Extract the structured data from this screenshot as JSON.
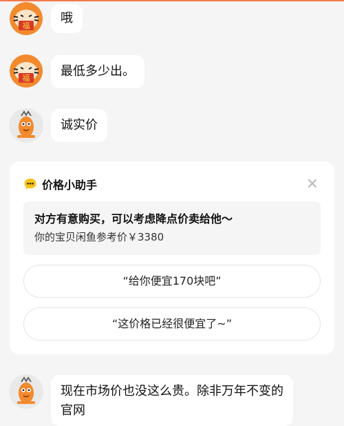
{
  "messages": [
    {
      "text": "哦",
      "avatar": "tiger-avatar"
    },
    {
      "text": "最低多少出。",
      "avatar": "tiger-avatar"
    },
    {
      "text": "诚实价",
      "avatar": "fish-mascot-avatar"
    },
    {
      "text": "现在市场价也没这么贵。除非万年不变的官网",
      "avatar": "fish-mascot-avatar"
    }
  ],
  "price_helper": {
    "title": "价格小助手",
    "tip": "对方有意购买，可以考虑降点价卖给他～",
    "reference_price": "你的宝贝闲鱼参考价￥3380",
    "quick_replies": [
      "“给你便宜170块吧”",
      "“这价格已经很便宜了~”"
    ]
  },
  "icons": {
    "close": "close-icon",
    "chat": "chat-bubble-icon"
  },
  "colors": {
    "accent_orange": "#f2784b",
    "chat_icon_yellow": "#f7c21b",
    "background": "#f5f5f5",
    "bubble": "#ffffff"
  }
}
